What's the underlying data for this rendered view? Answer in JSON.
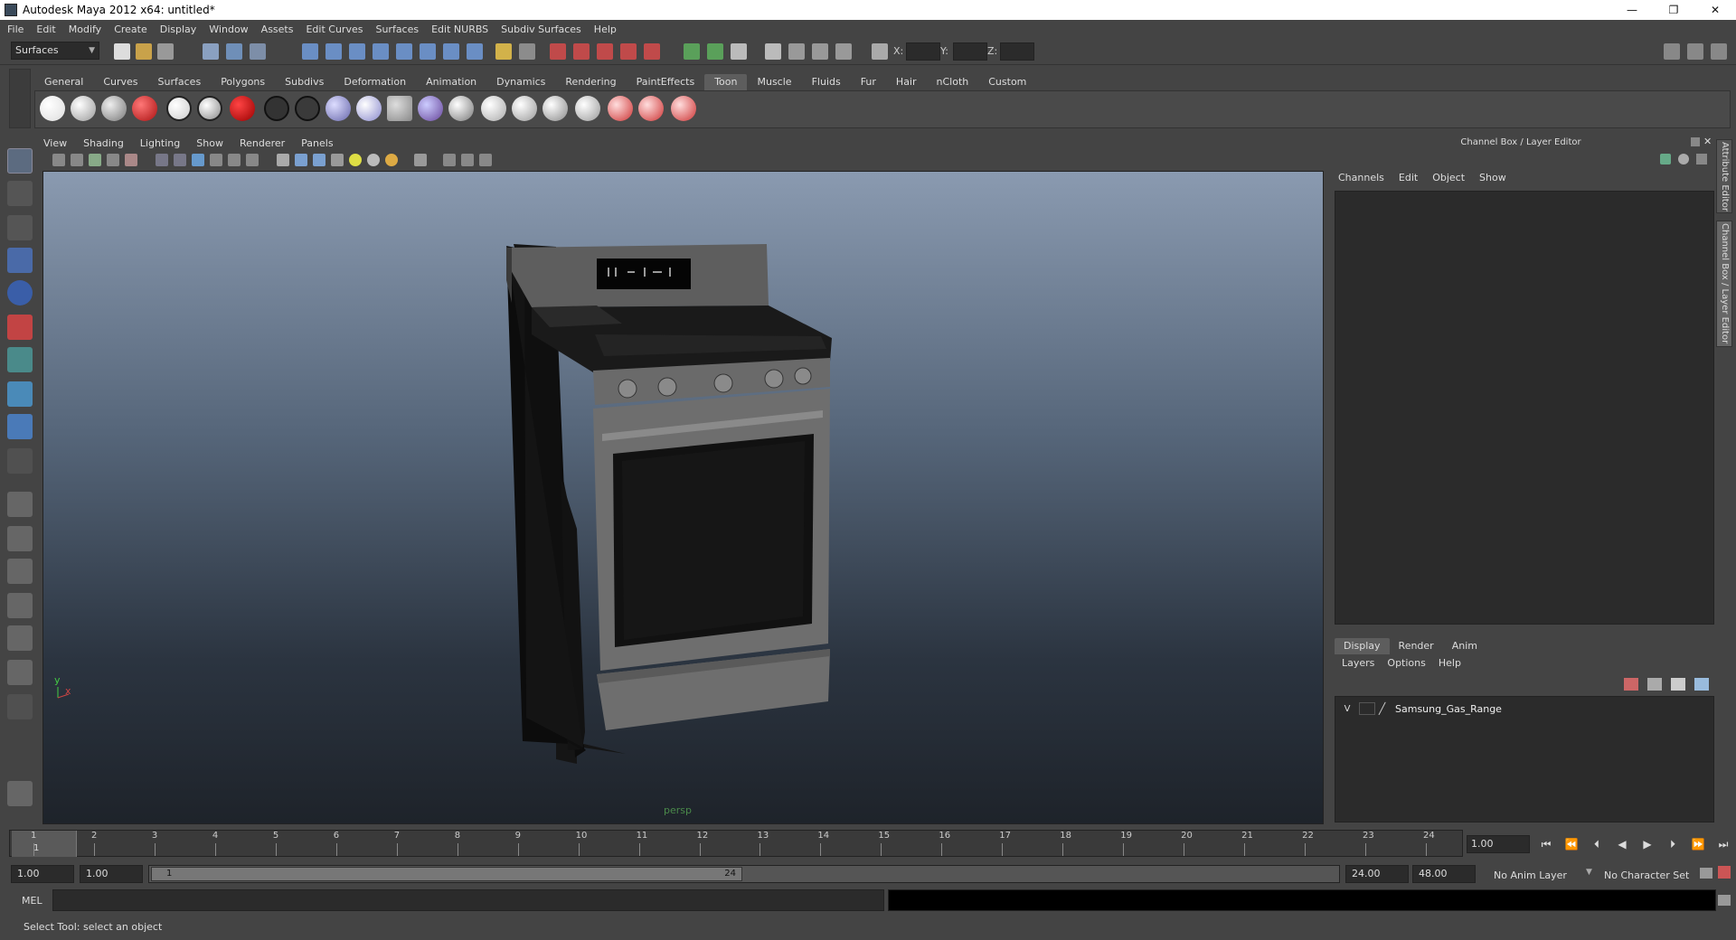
{
  "titlebar": {
    "title": "Autodesk Maya 2012 x64: untitled*",
    "minimize": "—",
    "maximize": "❐",
    "close": "✕"
  },
  "menubar": [
    "File",
    "Edit",
    "Modify",
    "Create",
    "Display",
    "Window",
    "Assets",
    "Edit Curves",
    "Surfaces",
    "Edit NURBS",
    "Subdiv Surfaces",
    "Help"
  ],
  "statusline": {
    "menu_set": "Surfaces",
    "x_label": "X:",
    "y_label": "Y:",
    "z_label": "Z:"
  },
  "shelf": {
    "tabs": [
      "General",
      "Curves",
      "Surfaces",
      "Polygons",
      "Subdivs",
      "Deformation",
      "Animation",
      "Dynamics",
      "Rendering",
      "PaintEffects",
      "Toon",
      "Muscle",
      "Fluids",
      "Fur",
      "Hair",
      "nCloth",
      "Custom"
    ],
    "active_tab": "Toon"
  },
  "viewport": {
    "menu": [
      "View",
      "Shading",
      "Lighting",
      "Show",
      "Renderer",
      "Panels"
    ],
    "camera_label": "persp",
    "axis_y": "y",
    "axis_x": "x"
  },
  "right_panel": {
    "header": "Channel Box / Layer Editor",
    "channel_menu": [
      "Channels",
      "Edit",
      "Object",
      "Show"
    ],
    "layer_tabs": [
      "Display",
      "Render",
      "Anim"
    ],
    "active_layer_tab": "Display",
    "layer_menu": [
      "Layers",
      "Options",
      "Help"
    ],
    "layers": [
      {
        "visible": "V",
        "name": "Samsung_Gas_Range"
      }
    ],
    "side_tabs": [
      "Attribute Editor",
      "Channel Box / Layer Editor"
    ]
  },
  "timeslider": {
    "ticks": [
      "1",
      "2",
      "3",
      "4",
      "5",
      "6",
      "7",
      "8",
      "9",
      "10",
      "11",
      "12",
      "13",
      "14",
      "15",
      "16",
      "17",
      "18",
      "19",
      "20",
      "21",
      "22",
      "23",
      "24"
    ],
    "current_frame_marker": "1",
    "current_time": "1.00"
  },
  "playback_controls": [
    "⏮",
    "⏪",
    "⏴",
    "◀",
    "▶",
    "⏵",
    "⏩",
    "⏭"
  ],
  "range_slider": {
    "start_time": "1.00",
    "playback_start": "1.00",
    "range_start_label": "1",
    "range_end_label": "24",
    "playback_end": "24.00",
    "end_time": "48.00",
    "anim_layer": "No Anim Layer",
    "character_set": "No Character Set"
  },
  "command_line": {
    "label": "MEL"
  },
  "help_line": "Select Tool: select an object"
}
